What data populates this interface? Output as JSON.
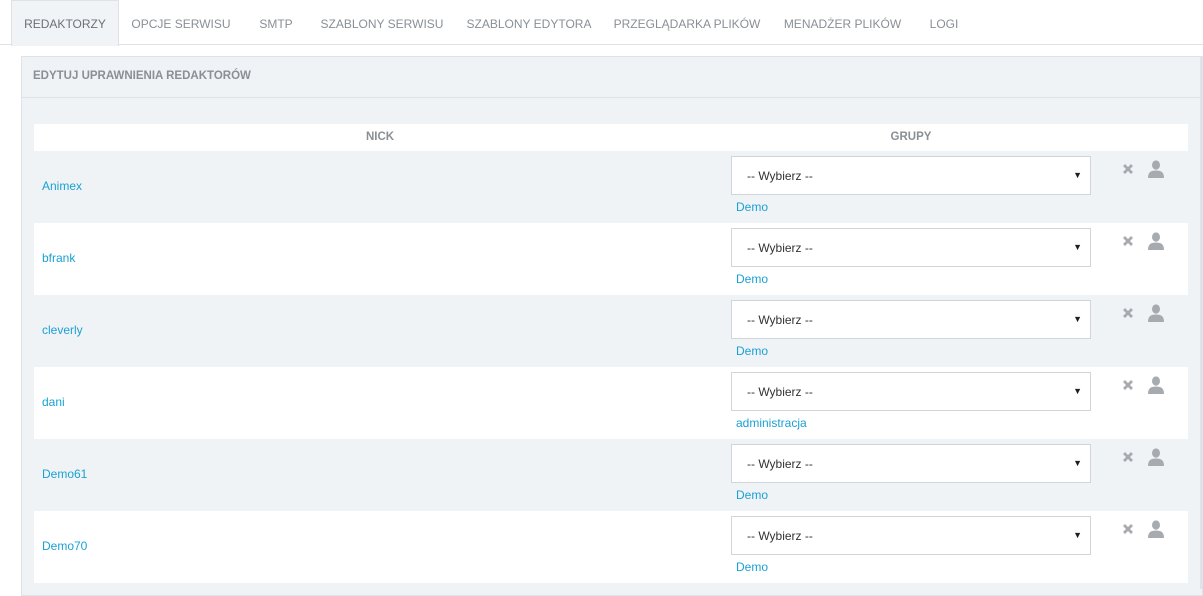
{
  "tabs": [
    {
      "label": "REDAKTORZY",
      "active": true
    },
    {
      "label": "OPCJE SERWISU",
      "active": false
    },
    {
      "label": "SMTP",
      "active": false
    },
    {
      "label": "SZABLONY SERWISU",
      "active": false
    },
    {
      "label": "SZABLONY EDYTORA",
      "active": false
    },
    {
      "label": "PRZEGLĄDARKA PLIKÓW",
      "active": false
    },
    {
      "label": "MENADŻER PLIKÓW",
      "active": false
    },
    {
      "label": "LOGI",
      "active": false
    }
  ],
  "panel": {
    "title": "EDYTUJ UPRAWNIENIA REDAKTORÓW"
  },
  "table": {
    "headers": {
      "nick": "NICK",
      "groups": "GRUPY"
    },
    "select_placeholder": "-- Wybierz --",
    "rows": [
      {
        "nick": "Animex",
        "group": "Demo"
      },
      {
        "nick": "bfrank",
        "group": "Demo"
      },
      {
        "nick": "cleverly",
        "group": "Demo"
      },
      {
        "nick": "dani",
        "group": "administracja"
      },
      {
        "nick": "Demo61",
        "group": "Demo"
      },
      {
        "nick": "Demo70",
        "group": "Demo"
      }
    ]
  },
  "icons": {
    "remove": "close-icon",
    "user": "user-icon"
  },
  "colors": {
    "link": "#1aa1d3",
    "icon": "#a7abaf",
    "panel_bg": "#f0f3f6",
    "border": "#dde3e8",
    "muted_text": "#8a8f94"
  }
}
